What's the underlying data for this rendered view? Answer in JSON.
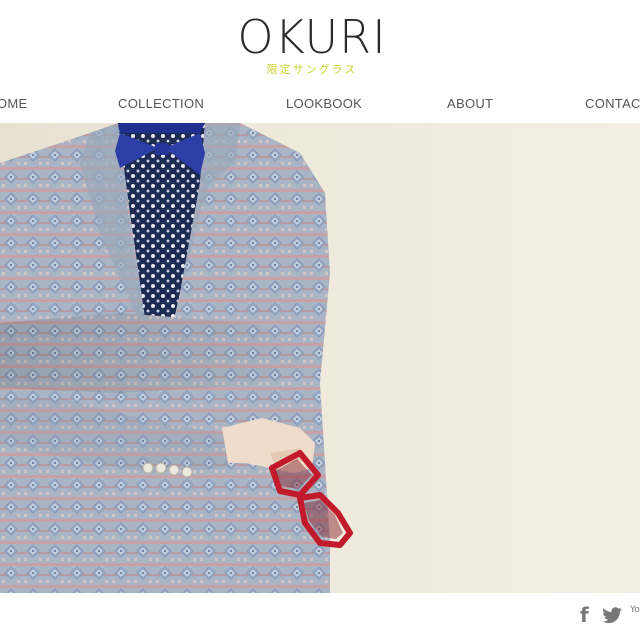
{
  "brand": {
    "name": "OKURI",
    "tagline": "限定サングラス",
    "accent_color": "#c8d22a"
  },
  "nav": {
    "items": [
      {
        "label": "HOME",
        "visible_text": "OME"
      },
      {
        "label": "COLLECTION"
      },
      {
        "label": "LOOKBOOK"
      },
      {
        "label": "ABOUT"
      },
      {
        "label": "CONTACT"
      }
    ]
  },
  "hero": {
    "image": "hero-photo-man-in-patterned-blazer-holding-red-sunglasses"
  },
  "social": {
    "facebook_icon": "facebook-icon",
    "facebook_glyph": "f",
    "twitter_icon": "twitter-icon",
    "youtube_icon": "youtube-icon",
    "youtube_glyph": "Yo"
  }
}
